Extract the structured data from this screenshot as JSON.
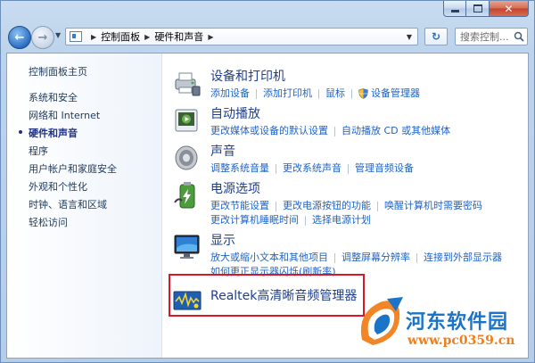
{
  "navigation": {
    "breadcrumb": [
      "控制面板",
      "硬件和声音"
    ],
    "search_placeholder": "搜索控制..."
  },
  "sidebar": {
    "items": [
      {
        "label": "控制面板主页",
        "active": false
      },
      {
        "label": "系统和安全",
        "active": false
      },
      {
        "label": "网络和 Internet",
        "active": false
      },
      {
        "label": "硬件和声音",
        "active": true
      },
      {
        "label": "程序",
        "active": false
      },
      {
        "label": "用户帐户和家庭安全",
        "active": false
      },
      {
        "label": "外观和个性化",
        "active": false
      },
      {
        "label": "时钟、语言和区域",
        "active": false
      },
      {
        "label": "轻松访问",
        "active": false
      }
    ]
  },
  "categories": [
    {
      "title": "设备和打印机",
      "icon": "printer-icon",
      "rows": [
        [
          "添加设备",
          "添加打印机",
          "鼠标",
          "设备管理器"
        ]
      ]
    },
    {
      "title": "自动播放",
      "icon": "autoplay-icon",
      "rows": [
        [
          "更改媒体或设备的默认设置",
          "自动播放 CD 或其他媒体"
        ]
      ]
    },
    {
      "title": "声音",
      "icon": "speaker-icon",
      "rows": [
        [
          "调整系统音量",
          "更改系统声音",
          "管理音频设备"
        ]
      ]
    },
    {
      "title": "电源选项",
      "icon": "battery-icon",
      "rows": [
        [
          "更改节能设置",
          "更改电源按钮的功能",
          "唤醒计算机时需要密码"
        ],
        [
          "更改计算机睡眠时间",
          "选择电源计划"
        ]
      ]
    },
    {
      "title": "显示",
      "icon": "monitor-icon",
      "rows": [
        [
          "放大或缩小文本和其他项目",
          "调整屏幕分辨率",
          "连接到外部显示器"
        ],
        [
          "如何更正显示器闪烁(刷新率)"
        ]
      ]
    },
    {
      "title": "Realtek高清晰音频管理器",
      "icon": "realtek-audio-icon",
      "rows": []
    }
  ],
  "watermark": {
    "title": "河东软件园",
    "url": "www.pc0359.cn"
  },
  "colors": {
    "highlight_box": "#d8182a",
    "link": "#1f63c8",
    "category_title": "#1f3f8c"
  }
}
